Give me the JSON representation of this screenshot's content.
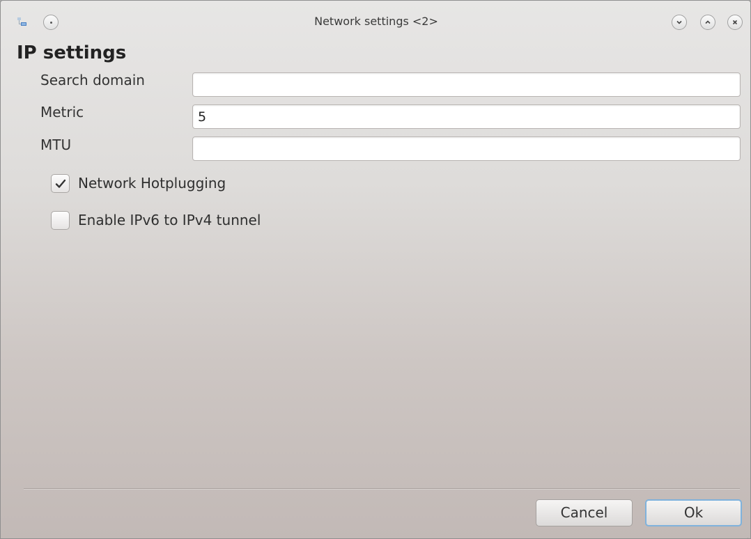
{
  "window": {
    "title": "Network settings <2>"
  },
  "heading": "IP settings",
  "fields": {
    "search_domain": {
      "label": "Search domain",
      "value": ""
    },
    "metric": {
      "label": "Metric",
      "value": "5"
    },
    "mtu": {
      "label": "MTU",
      "value": ""
    }
  },
  "checkboxes": {
    "hotplugging": {
      "label": "Network Hotplugging",
      "checked": true
    },
    "ipv6_tunnel": {
      "label": "Enable IPv6 to IPv4 tunnel",
      "checked": false
    }
  },
  "buttons": {
    "cancel": "Cancel",
    "ok": "Ok"
  },
  "icons": {
    "app": "network-icon",
    "menu": "window-menu-icon",
    "minimize": "chevron-down-icon",
    "maximize": "chevron-up-icon",
    "close": "close-icon",
    "check": "checkmark-icon"
  },
  "colors": {
    "focus_border": "#7fb2dc",
    "window_bg_top": "#e7e6e5",
    "window_bg_bottom": "#c2b9b6"
  }
}
